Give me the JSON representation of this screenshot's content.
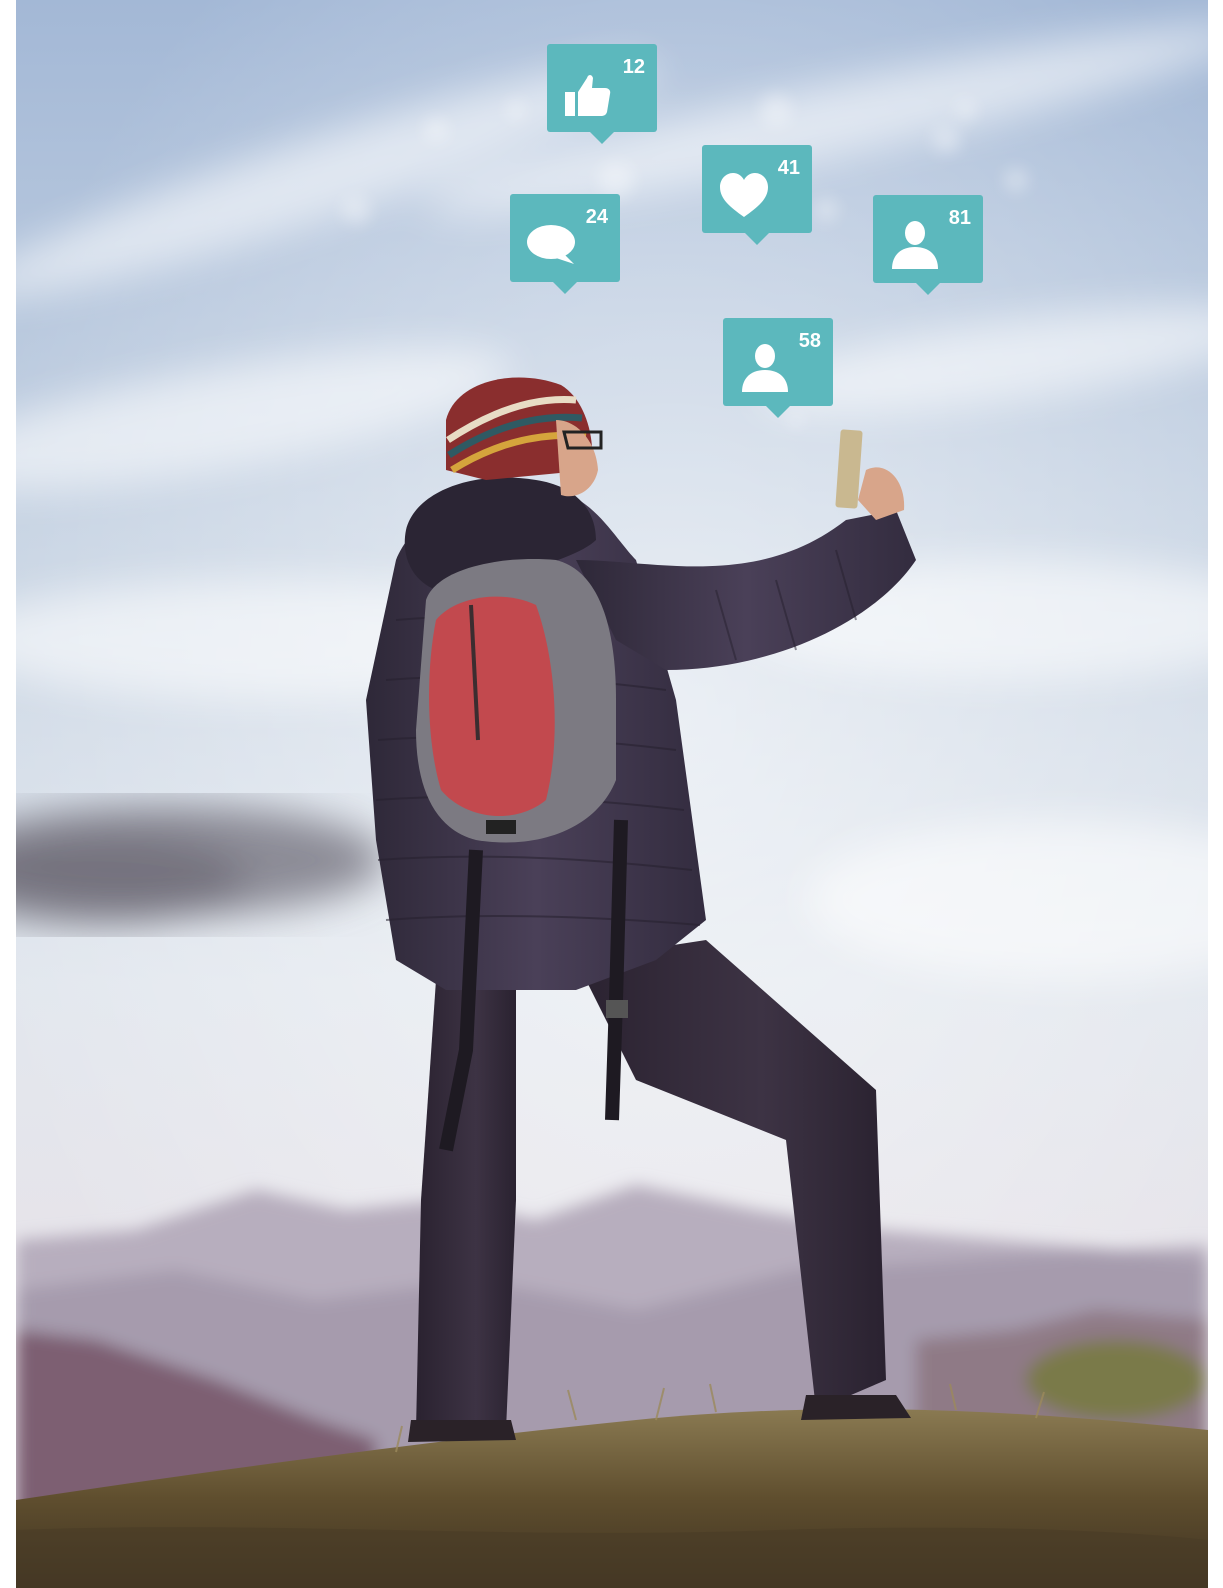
{
  "colors": {
    "badge": "#5cb8bd",
    "sky_top": "#a9bedb",
    "sky_mid": "#dfe6ee",
    "jacket": "#3a3244",
    "backpack_red": "#c2494e",
    "hat": "#8a2e2e",
    "grass": "#6d5a35"
  },
  "notifications": [
    {
      "id": "likes",
      "icon": "thumbs-up-icon",
      "count": "12"
    },
    {
      "id": "hearts",
      "icon": "heart-icon",
      "count": "41"
    },
    {
      "id": "comments",
      "icon": "speech-bubble-icon",
      "count": "24"
    },
    {
      "id": "followers-a",
      "icon": "user-icon",
      "count": "81"
    },
    {
      "id": "followers-b",
      "icon": "user-icon",
      "count": "58"
    }
  ]
}
